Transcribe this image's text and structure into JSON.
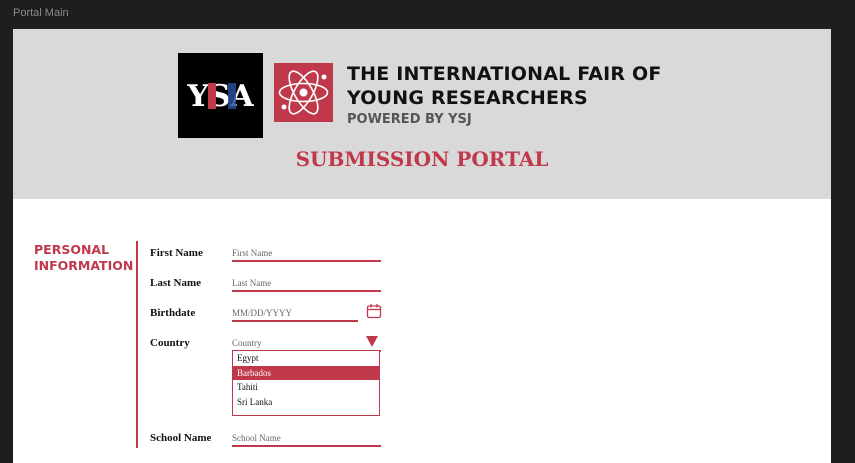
{
  "frame": {
    "label": "Portal Main"
  },
  "header": {
    "logo_ysa_text": "YSA",
    "title_line1": "THE INTERNATIONAL FAIR OF",
    "title_line2": "YOUNG RESEARCHERS",
    "powered_by": "POWERED BY YSJ",
    "portal_title": "SUBMISSION PORTAL"
  },
  "section": {
    "title_line1": "PERSONAL",
    "title_line2": "INFORMATION"
  },
  "fields": {
    "first_name": {
      "label": "First Name",
      "placeholder": "First Name"
    },
    "last_name": {
      "label": "Last Name",
      "placeholder": "Last Name"
    },
    "birthdate": {
      "label": "Birthdate",
      "placeholder": "MM/DD/YYYY"
    },
    "country": {
      "label": "Country",
      "placeholder": "Country",
      "options": [
        "Egypt",
        "Barbados",
        "Tahiti",
        "Sri Lanka"
      ],
      "highlighted": "Barbados"
    },
    "school_name": {
      "label": "School Name",
      "placeholder": "School Name"
    }
  },
  "colors": {
    "accent": "#c0394b",
    "header_bg": "#d9d9d9",
    "frame_bg": "#1e1e1e"
  },
  "icons": {
    "calendar": "calendar-icon",
    "dropdown": "caret-down-icon"
  }
}
